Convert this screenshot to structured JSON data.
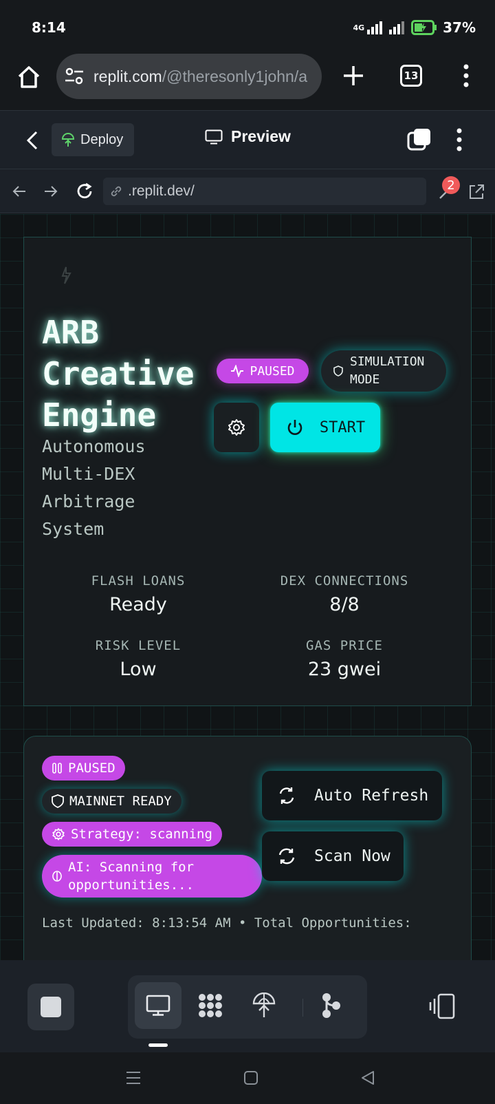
{
  "status_bar": {
    "time": "8:14",
    "network": "4G",
    "battery": "37%"
  },
  "browser": {
    "url_domain": "replit.com",
    "url_path": "/@theresonly1john/a",
    "tab_count": "13"
  },
  "replit_header": {
    "deploy_label": "Deploy",
    "preview_label": "Preview"
  },
  "webview": {
    "url": ".replit.dev/",
    "badge_count": "2"
  },
  "hero": {
    "title": "ARB Creative Engine",
    "subtitle": "Autonomous Multi-DEX Arbitrage System",
    "paused_badge": "PAUSED",
    "simulation_badge": "SIMULATION MODE",
    "start_label": "START",
    "stats": {
      "flash_loans": {
        "label": "FLASH LOANS",
        "value": "Ready"
      },
      "dex_connections": {
        "label": "DEX CONNECTIONS",
        "value": "8/8"
      },
      "risk_level": {
        "label": "RISK LEVEL",
        "value": "Low"
      },
      "gas_price": {
        "label": "GAS PRICE",
        "value": "23 gwei"
      }
    }
  },
  "status_panel": {
    "paused": "PAUSED",
    "mainnet": "MAINNET READY",
    "strategy": "Strategy: scanning",
    "ai": "AI: Scanning for opportunities...",
    "auto_refresh": "Auto Refresh",
    "scan_now": "Scan Now",
    "last_updated": "Last Updated: 8:13:54 AM • Total Opportunities:"
  },
  "colors": {
    "accent_cyan": "#00e5e5",
    "accent_magenta": "#c548e6",
    "glow_green": "#3cf082"
  }
}
